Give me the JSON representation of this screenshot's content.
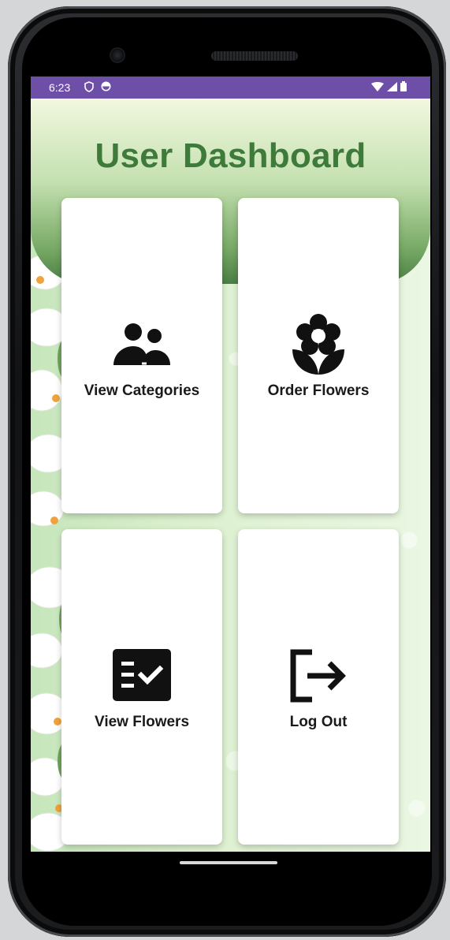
{
  "status_bar": {
    "time": "6:23",
    "left_icons": [
      "shield-icon",
      "data-saver-icon"
    ],
    "right_icons": [
      "wifi-icon",
      "cellular-signal-icon",
      "battery-icon"
    ]
  },
  "header": {
    "title": "User Dashboard"
  },
  "cards": [
    {
      "label": "View Categories",
      "icon": "people-icon"
    },
    {
      "label": "Order Flowers",
      "icon": "flower-icon"
    },
    {
      "label": "View Flowers",
      "icon": "checklist-icon"
    },
    {
      "label": "Log Out",
      "icon": "logout-icon"
    }
  ],
  "colors": {
    "status_bar": "#6e4fa8",
    "title": "#3e7b3b",
    "header_gradient_bottom": "#4b7e44",
    "card_background": "#ffffff"
  }
}
